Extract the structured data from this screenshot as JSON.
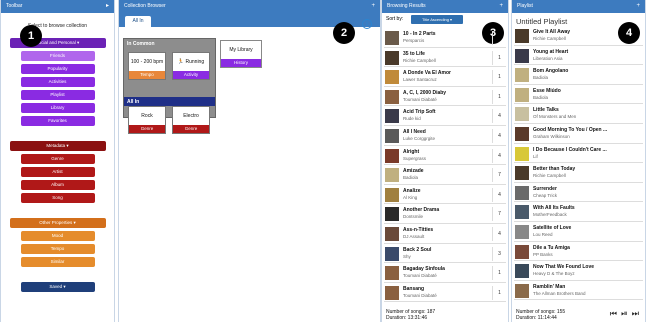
{
  "toolbar": {
    "title": "Toolbar",
    "hint": "Select to browse collection",
    "social_header": "Social and Personal ▾",
    "social_items": [
      "Friends",
      "Popularity",
      "Activities",
      "Playlist",
      "Library",
      "Favorites"
    ],
    "metadata_header": "Metadata ▾",
    "metadata_items": [
      "Genre",
      "Artist",
      "Album",
      "Song"
    ],
    "other_header": "Other Properties ▾",
    "other_items": [
      "Mood",
      "Tempo",
      "Similar"
    ],
    "saved_label": "Saved ▾",
    "badge": "1"
  },
  "browser": {
    "title": "Collection Browser",
    "tab": "All In",
    "badge": "2",
    "info_icon": "i",
    "in_common_label": "In Common",
    "all_in_label": "All In",
    "cards": [
      {
        "label": "100 - 200 bpm",
        "tag": "Tempo",
        "color": "#e8873a"
      },
      {
        "label": "Running",
        "tag": "Activity",
        "color": "#8a2be2"
      },
      {
        "label": "Rock",
        "tag": "Genre",
        "color": "#b01818"
      },
      {
        "label": "Electro",
        "tag": "Genre",
        "color": "#b01818"
      }
    ],
    "my_library": {
      "label": "My Library",
      "tag": "History",
      "color": "#8a2be2"
    }
  },
  "results": {
    "title": "Browsing Results",
    "badge": "3",
    "sort_label": "Sort by:",
    "sort_value": "Title Ascending ▾",
    "songs": [
      {
        "title": "10 - In 2 Parts",
        "artist": "Persparcis",
        "count": "",
        "color": "#6a5a4a"
      },
      {
        "title": "35 to Life",
        "artist": "Richie Campbell",
        "count": "1",
        "color": "#4a3a2a"
      },
      {
        "title": "A Donde Va El Amor",
        "artist": "Lawer Santacruz",
        "count": "1",
        "color": "#c08a3a"
      },
      {
        "title": "A, C, I, 2000 Diaby",
        "artist": "Toumani Diabaté",
        "count": "1",
        "color": "#8a6040"
      },
      {
        "title": "Acid Trip Soft",
        "artist": "Rude kid",
        "count": "4",
        "color": "#3a3a4a"
      },
      {
        "title": "All I Need",
        "artist": "Luke Corggrgite",
        "count": "4",
        "color": "#5a5a5a"
      },
      {
        "title": "Alright",
        "artist": "Supergrass",
        "count": "4",
        "color": "#7a3a2a"
      },
      {
        "title": "Amizade",
        "artist": "Badiola",
        "count": "7",
        "color": "#c0b080"
      },
      {
        "title": "Analize",
        "artist": "Al King",
        "count": "4",
        "color": "#a08040"
      },
      {
        "title": "Another Drama",
        "artist": "Dontsmile",
        "count": "7",
        "color": "#2a2a2a"
      },
      {
        "title": "Ass-n-Titties",
        "artist": "DJ Assault",
        "count": "4",
        "color": "#6a4a3a"
      },
      {
        "title": "Back 2 Soul",
        "artist": "Shy",
        "count": "3",
        "color": "#3a4a6a"
      },
      {
        "title": "Bagaday Sinfoula",
        "artist": "Toumani Diabaté",
        "count": "1",
        "color": "#8a6040"
      },
      {
        "title": "Bansang",
        "artist": "Toumani Diabaté",
        "count": "1",
        "color": "#8a6040"
      }
    ],
    "footer_count": "Number of songs: 187",
    "footer_duration": "Duration: 13:31:46"
  },
  "playlist": {
    "title": "Playlist",
    "badge": "4",
    "name": "Untitled Playlist",
    "songs": [
      {
        "title": "Give It All Away",
        "artist": "Richie Campbell",
        "color": "#4a3a2a"
      },
      {
        "title": "Young at Heart",
        "artist": "Liberation Asia",
        "color": "#3a3a4a"
      },
      {
        "title": "Bom Angolano",
        "artist": "Badiola",
        "color": "#c0b080"
      },
      {
        "title": "Esse Miúdo",
        "artist": "Badiola",
        "color": "#c0b080"
      },
      {
        "title": "Little Talks",
        "artist": "Of Monsters and Men",
        "color": "#c8c0a0"
      },
      {
        "title": "Good Morning To You / Open ...",
        "artist": "Graham Wilkinson",
        "color": "#5a3a2a"
      },
      {
        "title": "I Do Because I Couldn't Care ...",
        "artist": "Lif",
        "color": "#d8c838"
      },
      {
        "title": "Better than Today",
        "artist": "Richie Campbell",
        "color": "#4a3a2a"
      },
      {
        "title": "Surrender",
        "artist": "Cheap Trick",
        "color": "#6a6a6a"
      },
      {
        "title": "With All Its Faults",
        "artist": "MotherFeedback",
        "color": "#4a5a6a"
      },
      {
        "title": "Satellite of Love",
        "artist": "Lou Reed",
        "color": "#888888"
      },
      {
        "title": "Dile a Tu Amiga",
        "artist": "PP Banks",
        "color": "#7a4a3a"
      },
      {
        "title": "Now That We Found Love",
        "artist": "Heavy D & The Boyz",
        "color": "#3a4a5a"
      },
      {
        "title": "Ramblin' Man",
        "artist": "The Allman Brothers Band",
        "color": "#8a6a4a"
      }
    ],
    "footer_count": "Number of songs: 155",
    "footer_duration": "Duration: 11:14:44",
    "controls": "⏮ ⏯ ⏭"
  }
}
